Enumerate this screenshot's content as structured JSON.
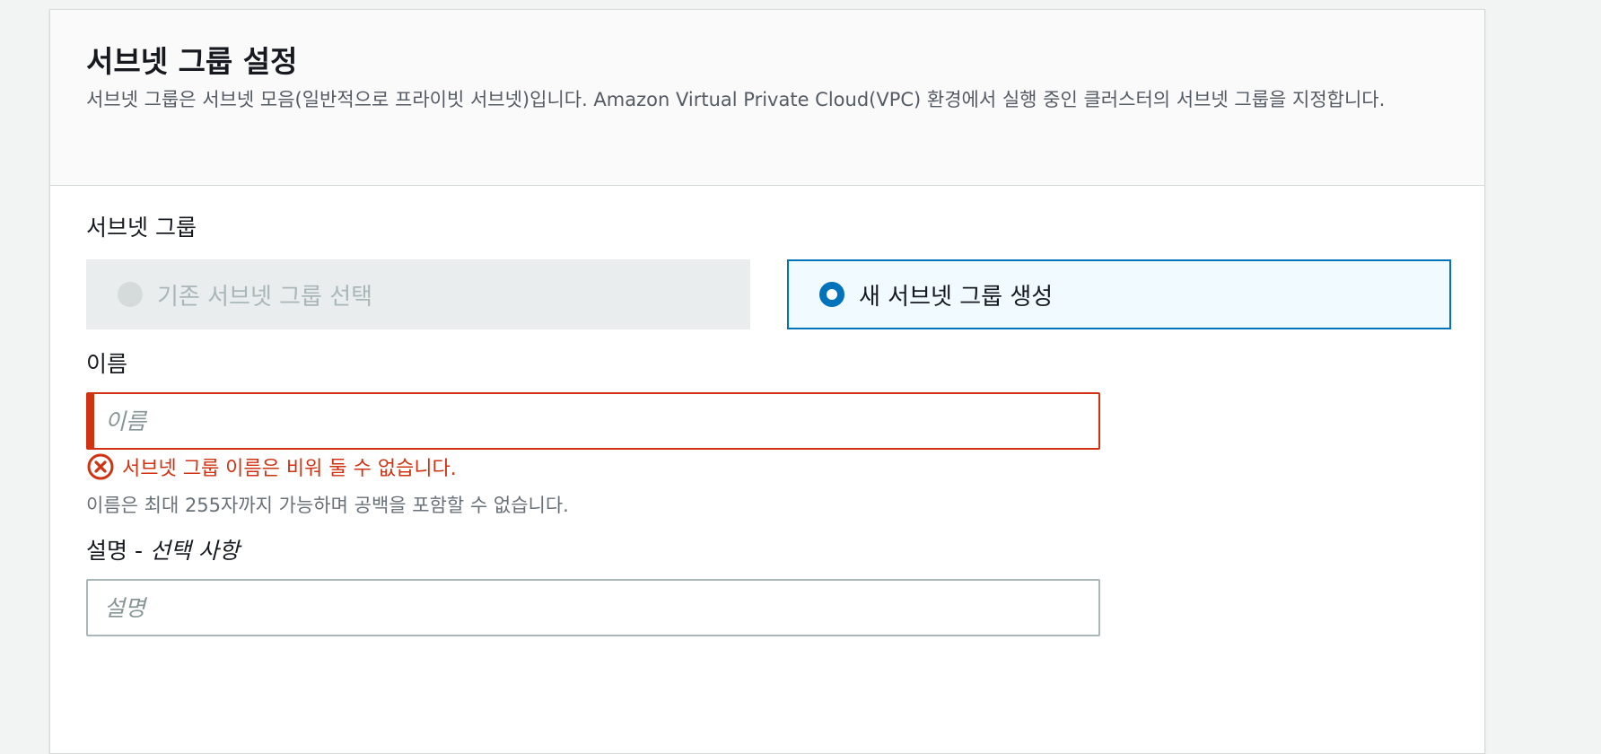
{
  "section": {
    "title": "서브넷 그룹 설정",
    "description": "서브넷 그룹은 서브넷 모음(일반적으로 프라이빗 서브넷)입니다. Amazon Virtual Private Cloud(VPC) 환경에서 실행 중인 클러스터의 서브넷 그룹을 지정합니다."
  },
  "subnet_group": {
    "label": "서브넷 그룹",
    "options": [
      {
        "label": "기존 서브넷 그룹 선택",
        "state": "disabled"
      },
      {
        "label": "새 서브넷 그룹 생성",
        "state": "selected"
      }
    ]
  },
  "name_field": {
    "label": "이름",
    "placeholder": "이름",
    "value": "",
    "error": "서브넷 그룹 이름은 비워 둘 수 없습니다.",
    "constraint": "이름은 최대 255자까지 가능하며 공백을 포함할 수 없습니다."
  },
  "description_field": {
    "label": "설명",
    "separator": " - ",
    "optional_label": "선택 사항",
    "placeholder": "설명",
    "value": ""
  },
  "colors": {
    "accent": "#0073bb",
    "error": "#d13212"
  }
}
